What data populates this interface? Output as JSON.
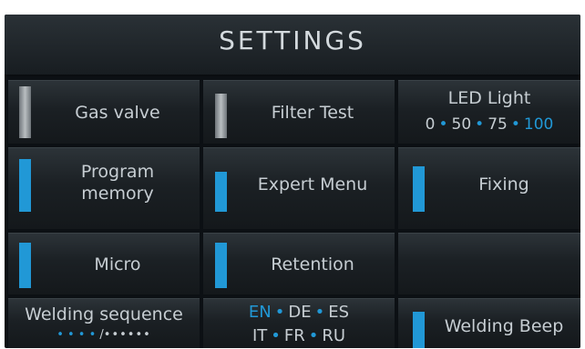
{
  "header": {
    "title": "SETTINGS"
  },
  "cells": {
    "gas_valve": {
      "label": "Gas valve",
      "state": "off"
    },
    "filter_test": {
      "label": "Filter Test",
      "state": "off"
    },
    "led_light": {
      "label": "LED Light",
      "options": [
        "0",
        "50",
        "75",
        "100"
      ],
      "selected": "100"
    },
    "program_memory": {
      "label_line1": "Program",
      "label_line2": "memory",
      "state": "on"
    },
    "expert_menu": {
      "label": "Expert Menu",
      "state": "on"
    },
    "fixing": {
      "label": "Fixing",
      "state": "on"
    },
    "micro": {
      "label": "Micro",
      "state": "on"
    },
    "retention": {
      "label": "Retention",
      "state": "on"
    },
    "welding_sequence": {
      "label": "Welding sequence",
      "sequence_active": "• • • •",
      "sequence_separator": "/",
      "sequence_rest": "••••••"
    },
    "language": {
      "row1": [
        "EN",
        "DE",
        "ES"
      ],
      "row2": [
        "IT",
        "FR",
        "RU"
      ],
      "selected": "EN"
    },
    "welding_beep": {
      "label": "Welding Beep",
      "state": "on"
    }
  },
  "colors": {
    "accent": "#2198d6",
    "text": "#c6cdd2",
    "panel_bg": "#0c1014"
  }
}
